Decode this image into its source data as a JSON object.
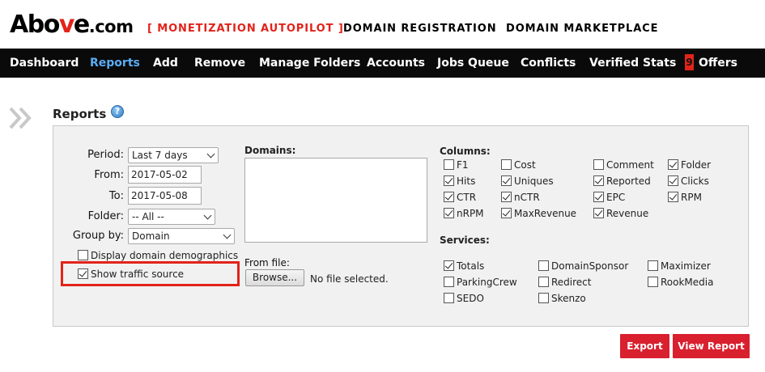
{
  "header": {
    "logo_main": "Abo",
    "logo_v": "v",
    "logo_e": "e",
    "logo_com": ".com",
    "monetization": "[ MONETIZATION AUTOPILOT ]",
    "domain_registration": "DOMAIN REGISTRATION",
    "domain_marketplace": "DOMAIN MARKETPLACE"
  },
  "nav": {
    "items": [
      "Dashboard",
      "Reports",
      "Add",
      "Remove",
      "Manage Folders",
      "Accounts",
      "Jobs Queue",
      "Conflicts",
      "Verified Stats"
    ],
    "offers_badge": "9",
    "offers_label": "Offers",
    "active": "Reports"
  },
  "page": {
    "title": "Reports",
    "help_icon": "question-circle-icon"
  },
  "form": {
    "period_label": "Period:",
    "period_value": "Last 7 days",
    "from_label": "From:",
    "from_value": "2017-05-02",
    "to_label": "To:",
    "to_value": "2017-05-08",
    "folder_label": "Folder:",
    "folder_value": "-- All --",
    "groupby_label": "Group by:",
    "groupby_value": "Domain",
    "display_demographics": "Display domain demographics",
    "show_traffic_source": "Show traffic source",
    "domains_label": "Domains:",
    "fromfile_label": "From file:",
    "browse_label": "Browse...",
    "file_status": "No file selected."
  },
  "columns": {
    "label": "Columns:",
    "items": [
      {
        "label": "F1",
        "checked": false
      },
      {
        "label": "Cost",
        "checked": false
      },
      {
        "label": "Comment",
        "checked": false
      },
      {
        "label": "Folder",
        "checked": true
      },
      {
        "label": "Hits",
        "checked": true
      },
      {
        "label": "Uniques",
        "checked": true
      },
      {
        "label": "Reported",
        "checked": true
      },
      {
        "label": "Clicks",
        "checked": true
      },
      {
        "label": "CTR",
        "checked": true
      },
      {
        "label": "nCTR",
        "checked": true
      },
      {
        "label": "EPC",
        "checked": true
      },
      {
        "label": "RPM",
        "checked": true
      },
      {
        "label": "nRPM",
        "checked": true
      },
      {
        "label": "MaxRevenue",
        "checked": true
      },
      {
        "label": "Revenue",
        "checked": true
      }
    ]
  },
  "services": {
    "label": "Services:",
    "items": [
      {
        "label": "Totals",
        "checked": true
      },
      {
        "label": "DomainSponsor",
        "checked": false
      },
      {
        "label": "Maximizer",
        "checked": false
      },
      {
        "label": "ParkingCrew",
        "checked": false
      },
      {
        "label": "Redirect",
        "checked": false
      },
      {
        "label": "RookMedia",
        "checked": false
      },
      {
        "label": "SEDO",
        "checked": false
      },
      {
        "label": "Skenzo",
        "checked": false
      }
    ]
  },
  "actions": {
    "export": "Export",
    "view_report": "View Report"
  },
  "colors": {
    "accent_red": "#e2231a",
    "nav_bg": "#0a0a0a",
    "nav_active": "#5aaef5",
    "button_red": "#d9202e"
  }
}
